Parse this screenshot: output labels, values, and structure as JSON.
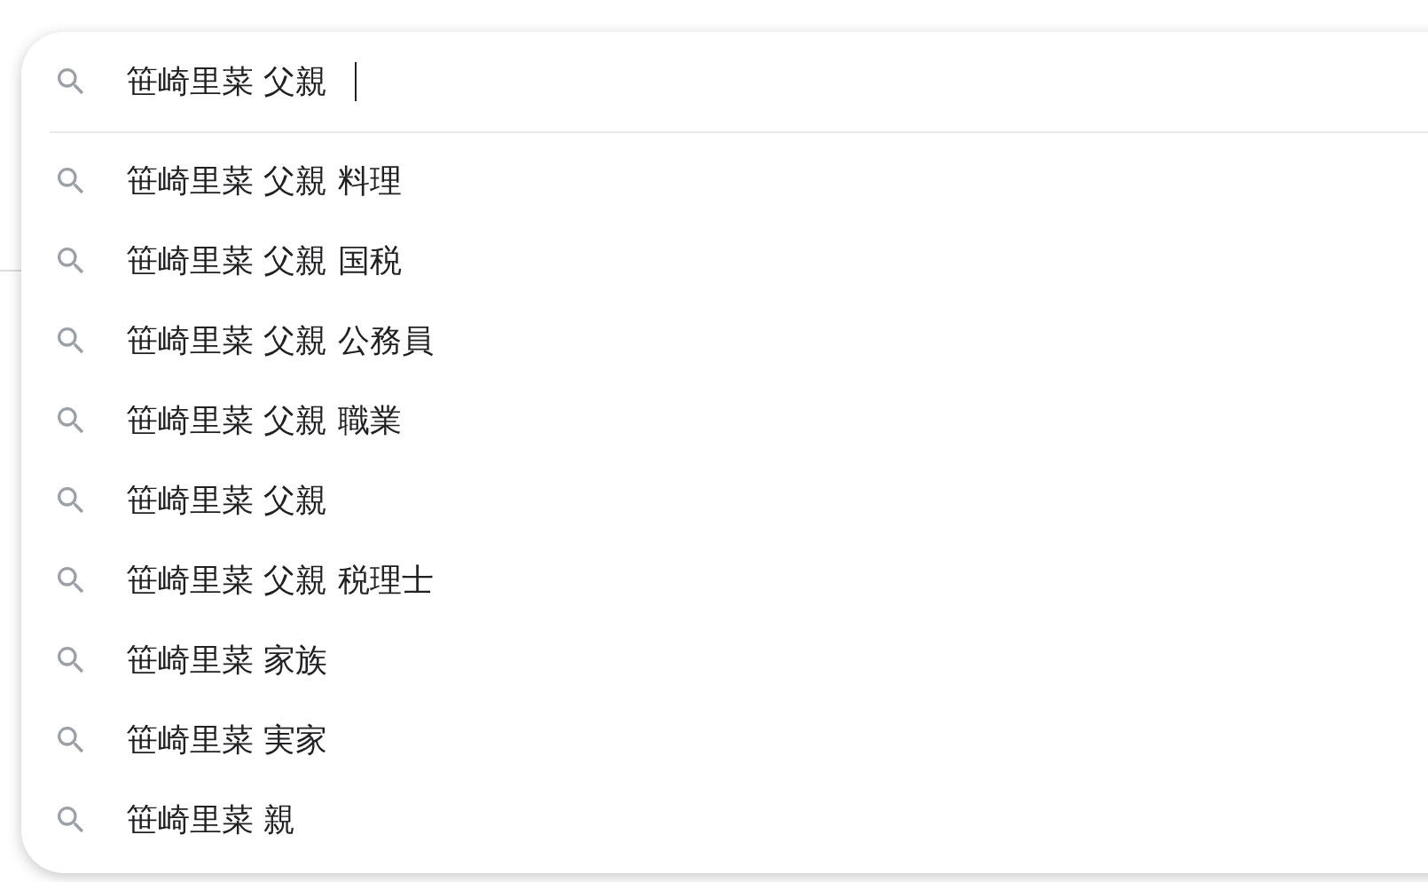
{
  "search": {
    "query": "笹崎里菜 父親 ",
    "focused": true
  },
  "suggestions": [
    {
      "text": "笹崎里菜 父親 料理"
    },
    {
      "text": "笹崎里菜 父親 国税"
    },
    {
      "text": "笹崎里菜 父親 公務員"
    },
    {
      "text": "笹崎里菜 父親 職業"
    },
    {
      "text": "笹崎里菜 父親"
    },
    {
      "text": "笹崎里菜 父親 税理士"
    },
    {
      "text": "笹崎里菜 家族"
    },
    {
      "text": "笹崎里菜 実家"
    },
    {
      "text": "笹崎里菜 親"
    }
  ]
}
